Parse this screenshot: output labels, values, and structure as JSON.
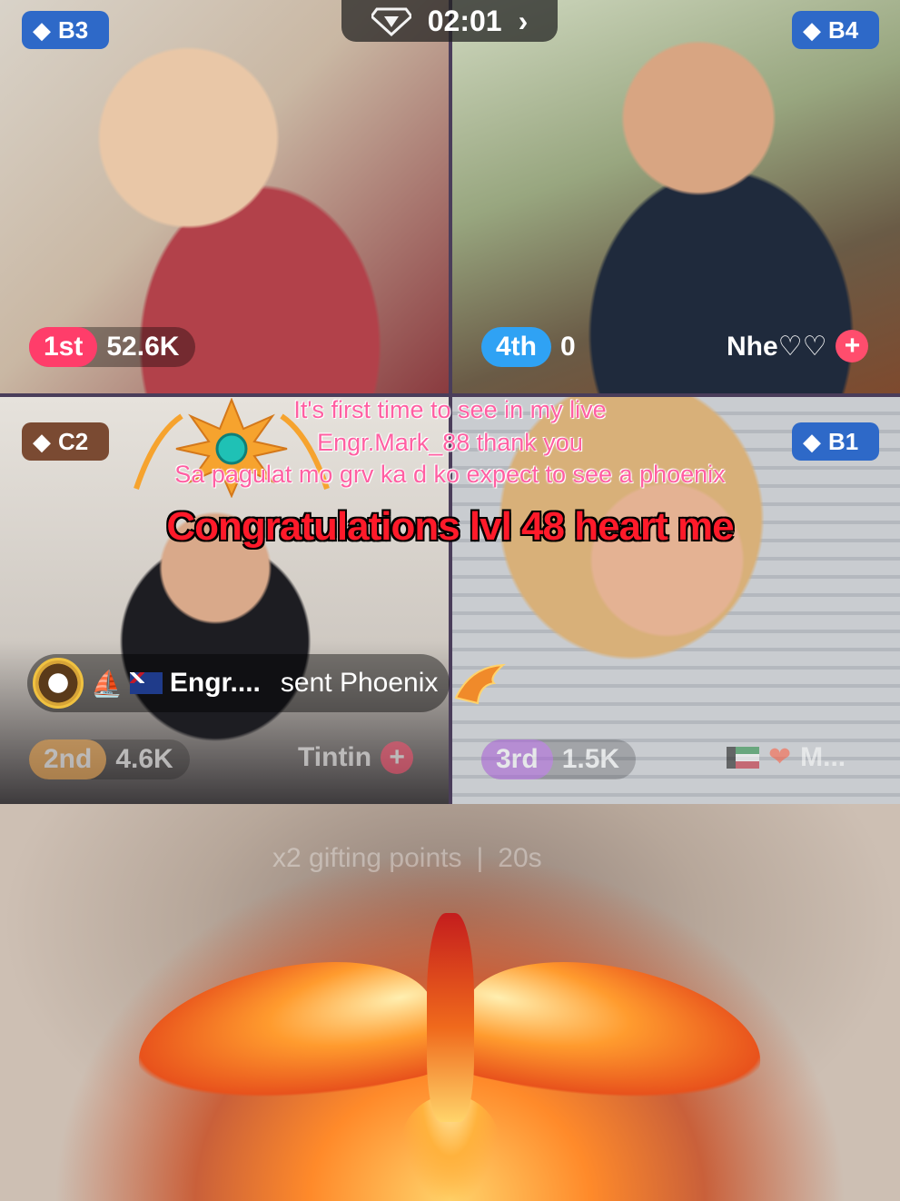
{
  "timer": {
    "value": "02:01",
    "icon": "diamond-trophy-icon",
    "chevron": "›"
  },
  "tiles": {
    "top_left": {
      "badge": "B3",
      "rank": "1st",
      "score": "52.6K"
    },
    "top_right": {
      "badge": "B4",
      "rank": "4th",
      "score": "0",
      "host": "Nhe♡♡"
    },
    "bottom_left": {
      "badge": "C2",
      "rank": "2nd",
      "score": "4.6K",
      "host": "Tintin"
    },
    "bottom_right": {
      "badge": "B1",
      "rank": "3rd",
      "score": "1.5K",
      "host": "M..."
    }
  },
  "gift_notice": {
    "sender": "Engr....",
    "message": "sent Phoenix"
  },
  "overlay": {
    "line1": "It's first time to see in my live",
    "line2": "Engr.Mark_88 thank you",
    "line3": "Sa pagulat mo grv ka d ko expect to see a phoenix",
    "congrats": "Congratulations lvl 48 heart me"
  },
  "gifting_hint": {
    "text": "x2 gifting points",
    "time": "20s"
  },
  "colors": {
    "first": "#ff3d6a",
    "second": "#f1a64a",
    "third": "#a75ad6",
    "fourth": "#2fa2f4",
    "badge_blue": "#2e69c8",
    "badge_brown": "#7a4a32"
  }
}
